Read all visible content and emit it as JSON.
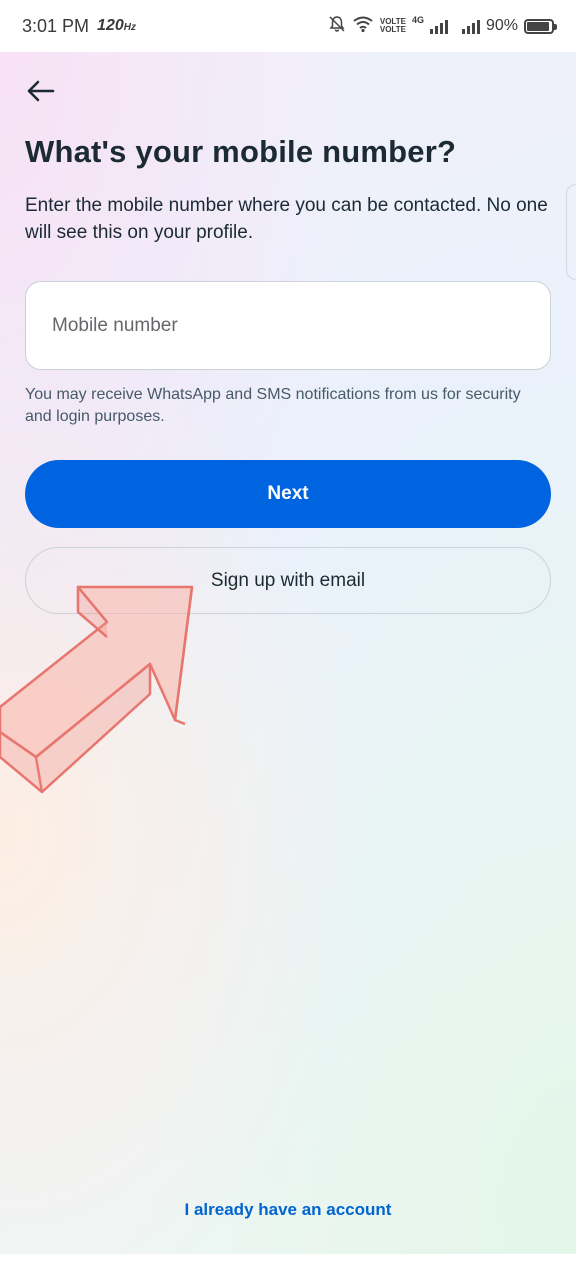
{
  "status_bar": {
    "time": "3:01 PM",
    "refresh_rate": "120",
    "refresh_unit": "Hz",
    "network_label_1": "VOLTE",
    "network_label_2": "VOLTE",
    "network_type": "4G",
    "battery_percent": "90%",
    "battery_level": 0.9,
    "icons": [
      "mute-bell-icon",
      "wifi-icon",
      "signal-icon",
      "signal-icon",
      "battery-icon"
    ]
  },
  "page": {
    "back_icon": "arrow-left-icon",
    "title": "What's your mobile number?",
    "subtitle": "Enter the mobile number where you can be contacted. No one will see this on your profile.",
    "mobile_input": {
      "placeholder": "Mobile number",
      "value": ""
    },
    "notice": "You may receive WhatsApp and SMS notifications from us for security and login purposes.",
    "next_button": "Next",
    "email_button": "Sign up with email",
    "login_link": "I already have an account"
  },
  "colors": {
    "primary": "#0064e0",
    "text": "#1c2b33",
    "link": "#0064d1",
    "annotation_arrow": "#f08080"
  }
}
